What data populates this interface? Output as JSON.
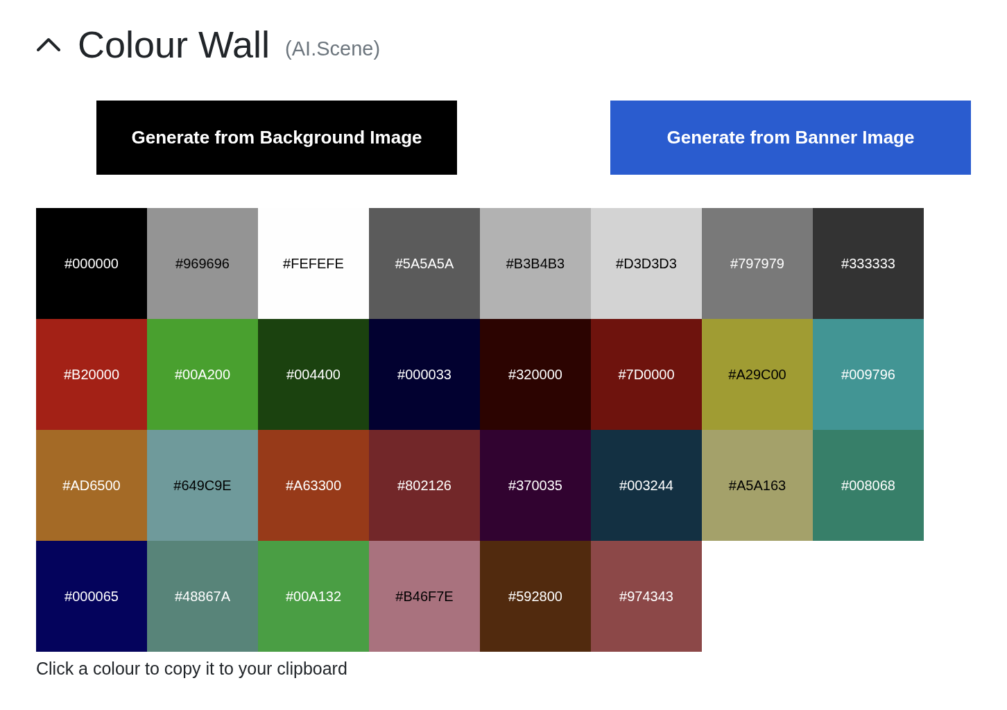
{
  "section": {
    "title": "Colour Wall",
    "subtitle": "(AI.Scene)",
    "expanded": true
  },
  "buttons": [
    {
      "label": "Generate from Background Image",
      "kind": "dark"
    },
    {
      "label": "Generate from Banner Image",
      "kind": "primary"
    }
  ],
  "swatches": [
    {
      "label": "#000000",
      "color": "#000000"
    },
    {
      "label": "#969696",
      "color": "#949494"
    },
    {
      "label": "#FEFEFE",
      "color": "#fefefe"
    },
    {
      "label": "#5A5A5A",
      "color": "#5b5b5b"
    },
    {
      "label": "#B3B4B3",
      "color": "#b2b2b2"
    },
    {
      "label": "#D3D3D3",
      "color": "#d3d3d3"
    },
    {
      "label": "#797979",
      "color": "#797979"
    },
    {
      "label": "#333333",
      "color": "#333333"
    },
    {
      "label": "#B20000",
      "color": "#a32116"
    },
    {
      "label": "#00A200",
      "color": "#49a02f"
    },
    {
      "label": "#004400",
      "color": "#1b420f"
    },
    {
      "label": "#000033",
      "color": "#020130"
    },
    {
      "label": "#320000",
      "color": "#2c0401"
    },
    {
      "label": "#7D0000",
      "color": "#6e130d"
    },
    {
      "label": "#A29C00",
      "color": "#a09c33"
    },
    {
      "label": "#009796",
      "color": "#429594"
    },
    {
      "label": "#AD6500",
      "color": "#a46a26"
    },
    {
      "label": "#649C9E",
      "color": "#6f9a9b"
    },
    {
      "label": "#A63300",
      "color": "#973a19"
    },
    {
      "label": "#802126",
      "color": "#722729"
    },
    {
      "label": "#370035",
      "color": "#310330"
    },
    {
      "label": "#003244",
      "color": "#133042"
    },
    {
      "label": "#A5A163",
      "color": "#a4a16a"
    },
    {
      "label": "#008068",
      "color": "#377f69"
    },
    {
      "label": "#000065",
      "color": "#04035c"
    },
    {
      "label": "#48867A",
      "color": "#588479"
    },
    {
      "label": "#00A132",
      "color": "#4a9e44"
    },
    {
      "label": "#B46F7E",
      "color": "#a9727e"
    },
    {
      "label": "#592800",
      "color": "#512a0e"
    },
    {
      "label": "#974343",
      "color": "#8c4848"
    }
  ],
  "hint": "Click a colour to copy it to your clipboard"
}
